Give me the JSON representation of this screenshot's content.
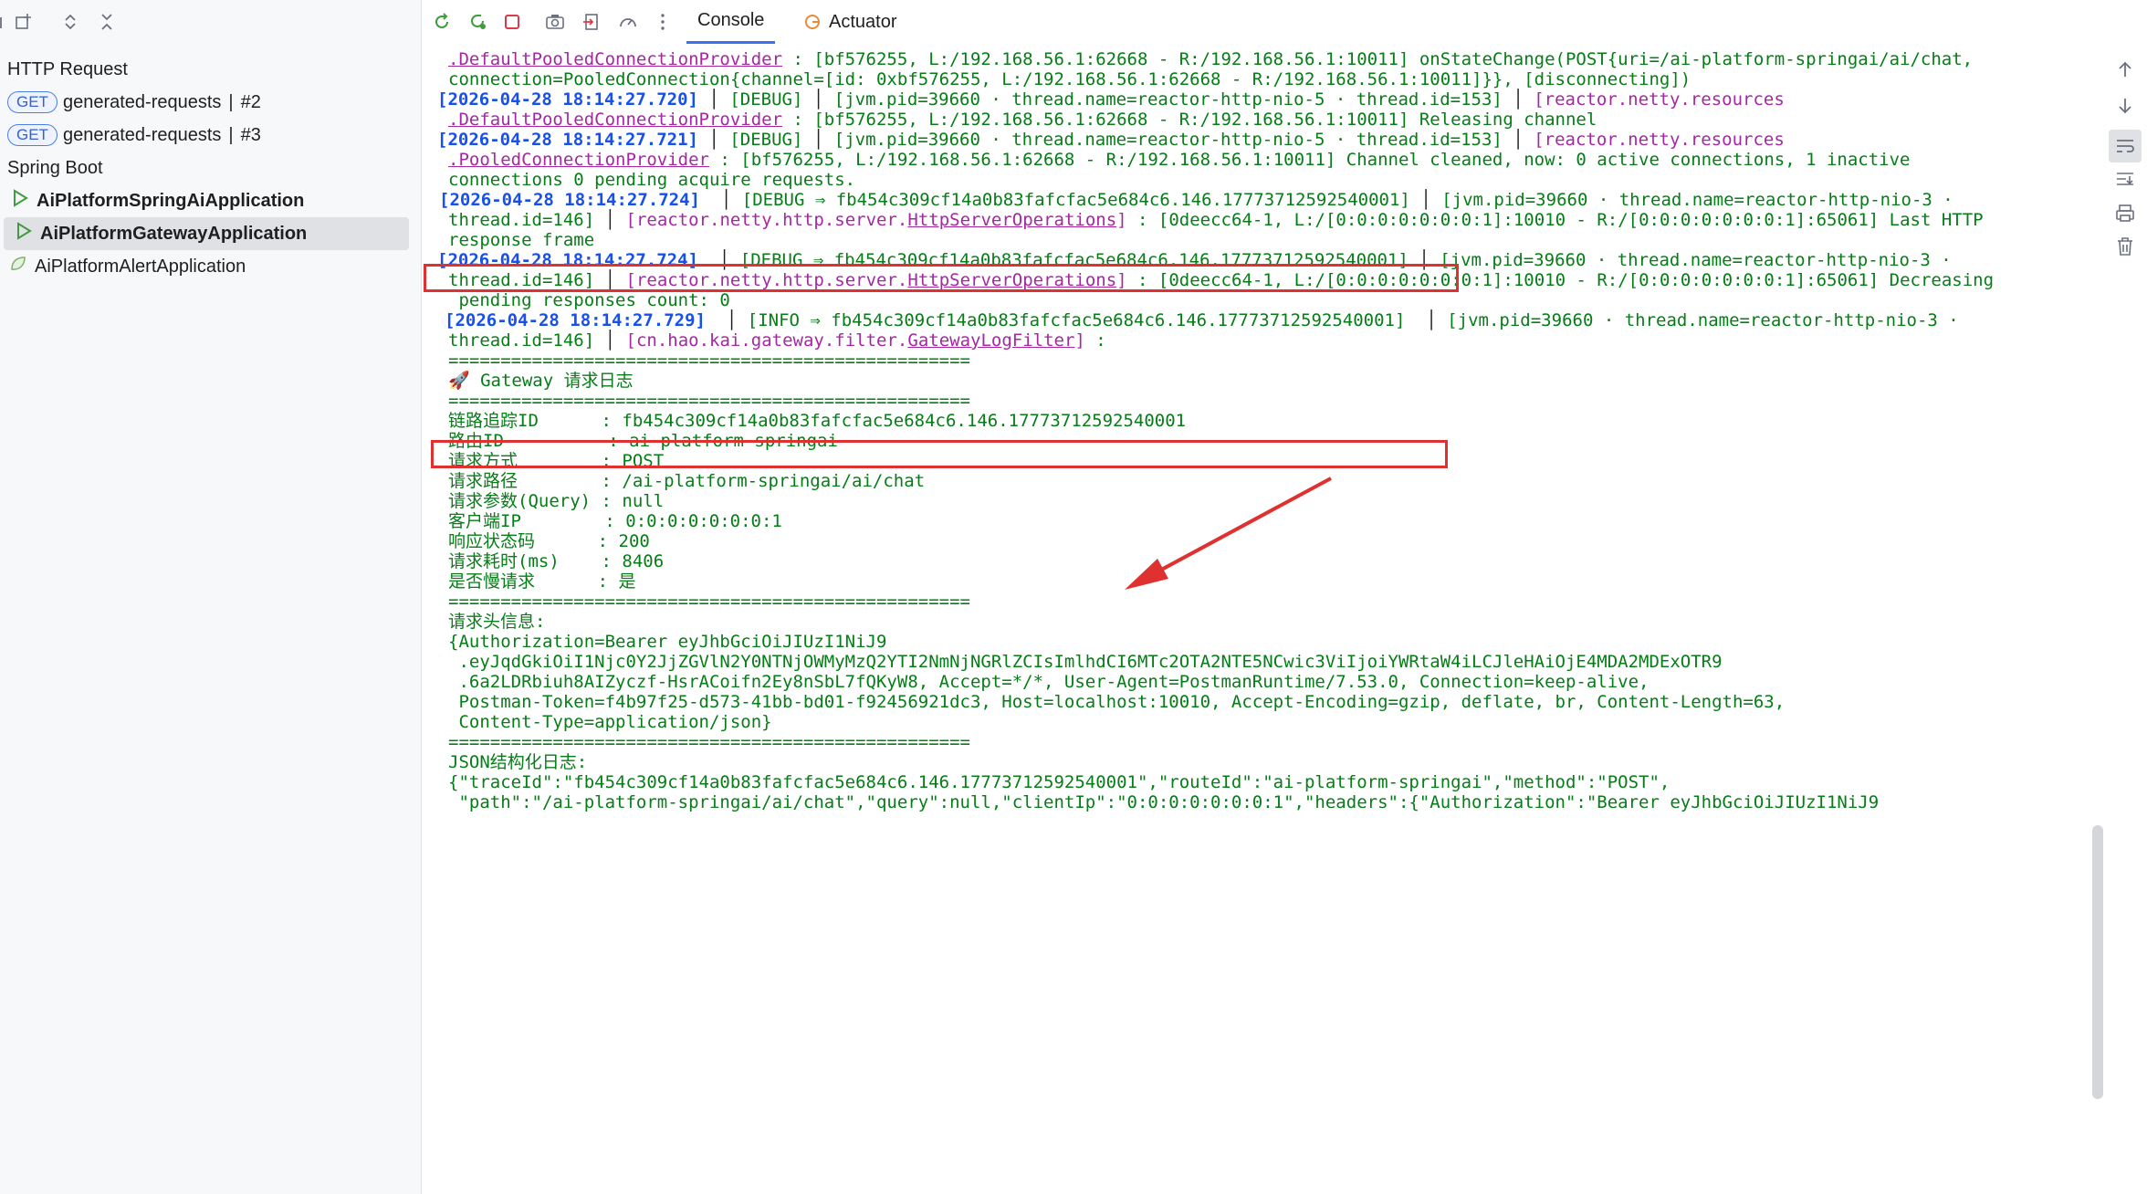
{
  "left_panel": {
    "toolbar_icons": [
      "new-window-icon",
      "expand-collapse-icon",
      "collapse-icon"
    ],
    "tree": [
      {
        "label": "HTTP Request",
        "type": "group"
      },
      {
        "badge": "GET",
        "label": "generated-requests",
        "sep": "|",
        "suffix": "#2",
        "type": "request"
      },
      {
        "badge": "GET",
        "label": "generated-requests",
        "sep": "|",
        "suffix": "#3",
        "type": "request"
      },
      {
        "label": "Spring Boot",
        "type": "group"
      },
      {
        "label": "AiPlatformSpringAiApplication",
        "type": "app",
        "running": true
      },
      {
        "label": "AiPlatformGatewayApplication",
        "type": "app",
        "running": true,
        "selected": true
      },
      {
        "label": "AiPlatformAlertApplication",
        "type": "app",
        "running": false
      }
    ]
  },
  "toolbar": {
    "icons": [
      "rerun-icon",
      "restart-icon",
      "stop-icon",
      "camera-icon",
      "exit-icon",
      "gauge-icon",
      "more-icon"
    ],
    "tabs": [
      {
        "label": "Console",
        "active": true
      },
      {
        "label": "Actuator",
        "active": false
      }
    ]
  },
  "console": {
    "l01": ".DefaultPooledConnectionProvider",
    "l01b": " : [bf576255, L:/192.168.56.1:62668 - R:/192.168.56.1:10011] onStateChange(POST{uri=/ai-platform-springai/ai/chat,",
    "l02": "connection=PooledConnection{channel=[id: 0xbf576255, L:/192.168.56.1:62668 - R:/192.168.56.1:10011]}}, [disconnecting])",
    "l03_ts": "[2026-04-28 18:14:27.720]",
    "l03_lv": "[DEBUG]",
    "l03_th": "[jvm.pid=39660 · thread.name=reactor-http-nio-5 · thread.id=153]",
    "l03_lg": "[reactor.netty.resources",
    "l04": ".DefaultPooledConnectionProvider",
    "l04b": " : [bf576255, L:/192.168.56.1:62668 - R:/192.168.56.1:10011] Releasing channel",
    "l05_ts": "[2026-04-28 18:14:27.721]",
    "l05_lv": "[DEBUG]",
    "l05_th": "[jvm.pid=39660 · thread.name=reactor-http-nio-5 · thread.id=153]",
    "l05_lg": "[reactor.netty.resources",
    "l06": ".PooledConnectionProvider",
    "l06b": " : [bf576255, L:/192.168.56.1:62668 - R:/192.168.56.1:10011] Channel cleaned, now: 0 active connections, 1 inactive",
    "l07": "connections 0 pending acquire requests.",
    "l08_ts": "[2026-04-28 18:14:27.724]",
    "l08_lv": "[DEBUG ⇒ fb454c309cf14a0b83fafcfac5e684c6.146.17773712592540001]",
    "l08_th": "[jvm.pid=39660 · thread.name=reactor-http-nio-3 ·",
    "l09_th": "thread.id=146]",
    "l09_lg_a": "[reactor.netty.http.server.",
    "l09_lg_b": "HttpServerOperations",
    "l09_lg_c": "]",
    "l09_msg": " : [0deecc64-1, L:/[0:0:0:0:0:0:0:1]:10010 - R:/[0:0:0:0:0:0:0:1]:65061] Last HTTP",
    "l10": "response frame",
    "l11_ts": "[2026-04-28 18:14:27.724]",
    "l11_lv": "[DEBUG ⇒ fb454c309cf14a0b83fafcfac5e684c6.146.17773712592540001]",
    "l11_th": "[jvm.pid=39660 · thread.name=reactor-http-nio-3 ·",
    "l12_th": "thread.id=146]",
    "l12_lg_a": "[reactor.netty.http.server.",
    "l12_lg_b": "HttpServerOperations",
    "l12_lg_c": "]",
    "l12_msg": " : [0deecc64-1, L:/[0:0:0:0:0:0:0:1]:10010 - R:/[0:0:0:0:0:0:0:1]:65061] Decreasing",
    "l13": " pending responses count: 0",
    "l14_ts": "[2026-04-28 18:14:27.729]",
    "l14_lv": "[INFO ⇒ fb454c309cf14a0b83fafcfac5e684c6.146.17773712592540001]",
    "l14_th": "[jvm.pid=39660 · thread.name=reactor-http-nio-3 ·",
    "l15_th": "thread.id=146]",
    "l15_lg_a": "[cn.hao.kai.gateway.filter.",
    "l15_lg_b": "GatewayLogFilter",
    "l15_lg_c": "]",
    "l15_msg": " :",
    "divider": "==================================================",
    "l17": "🚀 Gateway 请求日志",
    "l19": "链路追踪ID      : fb454c309cf14a0b83fafcfac5e684c6.146.17773712592540001",
    "l20": "路由ID          : ai-platform-springai",
    "l21": "请求方式        : POST",
    "l22": "请求路径        : /ai-platform-springai/ai/chat",
    "l23": "请求参数(Query) : null",
    "l24": "客户端IP        : 0:0:0:0:0:0:0:1",
    "l25": "响应状态码      : 200",
    "l26": "请求耗时(ms)    : 8406",
    "l27": "是否慢请求      : 是",
    "l29": "请求头信息:",
    "l30": "{Authorization=Bearer eyJhbGciOiJIUzI1NiJ9",
    "l31": " .eyJqdGkiOiI1Njc0Y2JjZGVlN2Y0NTNjOWMyMzQ2YTI2NmNjNGRlZCIsImlhdCI6MTc2OTA2NTE5NCwic3ViIjoiYWRtaW4iLCJleHAiOjE4MDA2MDExOTR9",
    "l32": " .6a2LDRbiuh8AIZyczf-HsrACoifn2Ey8nSbL7fQKyW8, Accept=*/*, User-Agent=PostmanRuntime/7.53.0, Connection=keep-alive,",
    "l33": " Postman-Token=f4b97f25-d573-41bb-bd01-f92456921dc3, Host=localhost:10010, Accept-Encoding=gzip, deflate, br, Content-Length=63,",
    "l34": " Content-Type=application/json}",
    "l36": "JSON结构化日志:",
    "l37": "{\"traceId\":\"fb454c309cf14a0b83fafcfac5e684c6.146.17773712592540001\",\"routeId\":\"ai-platform-springai\",\"method\":\"POST\",",
    "l38": " \"path\":\"/ai-platform-springai/ai/chat\",\"query\":null,\"clientIp\":\"0:0:0:0:0:0:0:1\",\"headers\":{\"Authorization\":\"Bearer eyJhbGciOiJIUzI1NiJ9"
  },
  "right_sidebar_icons": [
    "scroll-up-icon",
    "scroll-down-icon",
    "soft-wrap-icon",
    "scroll-to-end-icon",
    "print-icon",
    "clear-icon"
  ],
  "colors": {
    "timestamp": "#1750eb",
    "text": "#067d17",
    "logger": "#a626a4",
    "highlight": "#e03131",
    "accent": "#3574f0"
  }
}
